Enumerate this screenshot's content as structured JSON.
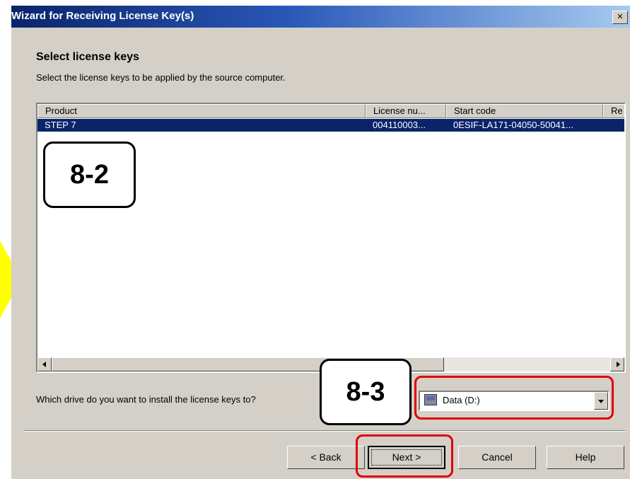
{
  "window": {
    "title": "Wizard for Receiving License Key(s)",
    "close_glyph": "×"
  },
  "page": {
    "heading": "Select license keys",
    "subheading": "Select the license keys to be applied by the source computer."
  },
  "license_list": {
    "columns": [
      "Product",
      "License nu...",
      "Start code",
      "Re"
    ],
    "rows": [
      {
        "product": "STEP 7",
        "license_number": "004110003...",
        "start_code": "0ESIF-LA171-04050-50041..."
      }
    ],
    "selected_row": 0
  },
  "drive": {
    "question": "Which drive do you want to install the license keys to?",
    "selected": "Data (D:)",
    "icon": "hard-drive-icon"
  },
  "buttons": {
    "back": "< Back",
    "next": "Next >",
    "cancel": "Cancel",
    "help": "Help"
  },
  "annotations": {
    "callout_list": "8-2",
    "callout_drive": "8-3",
    "highlight_color": "#e10000",
    "arrow_color": "#ffff00"
  }
}
